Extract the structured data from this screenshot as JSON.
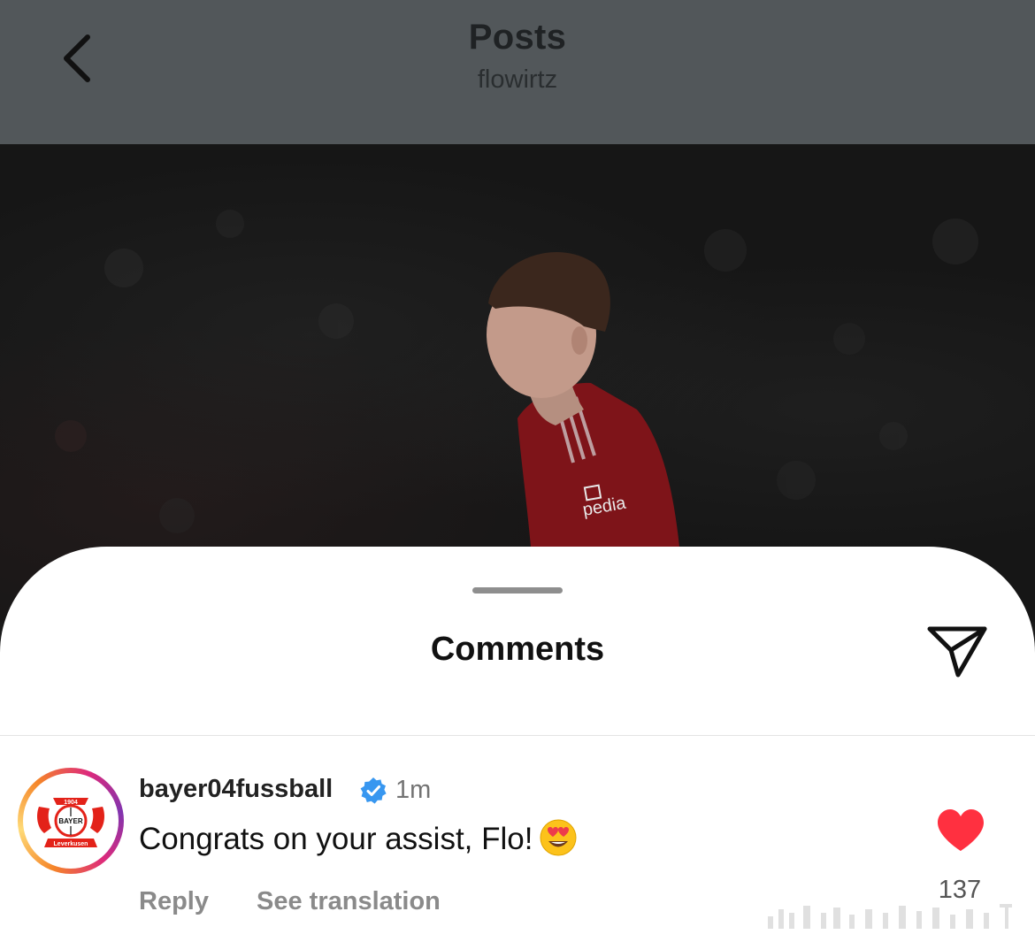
{
  "header": {
    "title": "Posts",
    "subtitle": "flowirtz"
  },
  "post": {
    "jersey_sponsor": "pedia"
  },
  "comments_sheet": {
    "title": "Comments",
    "comment": {
      "username": "bayer04fussball",
      "verified": true,
      "time": "1m",
      "text": "Congrats on your assist, Flo!",
      "emoji": "heart-eyes-emoji",
      "reply_label": "Reply",
      "translation_label": "See translation",
      "liked": true,
      "like_count": "137",
      "avatar_logo_text": {
        "year": "1904",
        "brand": "BAYER",
        "city": "Leverkusen"
      }
    }
  },
  "colors": {
    "header_bg": "#52575a",
    "heart": "#ff3040",
    "verified": "#3897f0",
    "club_red": "#e32219"
  },
  "icons": {
    "back": "chevron-left-icon",
    "share": "paper-plane-icon",
    "verified": "verified-badge-icon",
    "like": "heart-icon"
  }
}
